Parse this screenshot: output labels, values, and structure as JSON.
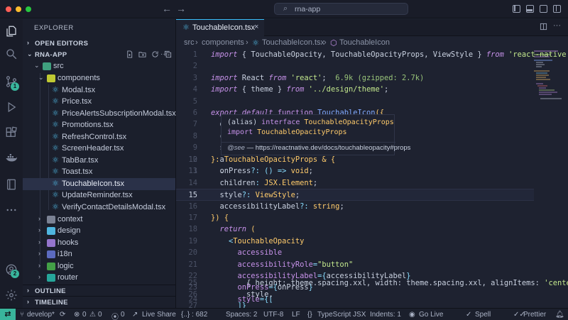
{
  "window": {
    "search_text": "rna-app"
  },
  "sidebar": {
    "title": "EXPLORER",
    "open_editors": "OPEN EDITORS",
    "project": "RNA-APP",
    "outline": "OUTLINE",
    "timeline": "TIMELINE",
    "tree": [
      {
        "name": "src"
      },
      {
        "name": "components"
      },
      {
        "name": "Modal.tsx"
      },
      {
        "name": "Price.tsx"
      },
      {
        "name": "PriceAlertsSubscriptionModal.tsx"
      },
      {
        "name": "Promotions.tsx"
      },
      {
        "name": "RefreshControl.tsx"
      },
      {
        "name": "ScreenHeader.tsx"
      },
      {
        "name": "TabBar.tsx"
      },
      {
        "name": "Toast.tsx"
      },
      {
        "name": "TouchableIcon.tsx"
      },
      {
        "name": "UpdateReminder.tsx"
      },
      {
        "name": "VerifyContactDetailsModal.tsx"
      },
      {
        "name": "context"
      },
      {
        "name": "design"
      },
      {
        "name": "hooks"
      },
      {
        "name": "i18n"
      },
      {
        "name": "logic"
      },
      {
        "name": "router"
      }
    ]
  },
  "activity": {
    "scm_badge": "1",
    "account_badge": "2"
  },
  "tab": {
    "label": "TouchableIcon.tsx"
  },
  "breadcrumb": [
    "src",
    "components",
    "TouchableIcon.tsx",
    "TouchableIcon"
  ],
  "code": {
    "line_numbers": [
      "1",
      "2",
      "3",
      "4",
      "5",
      "6",
      "7",
      "8",
      "9",
      "10",
      "11",
      "12",
      "13",
      "14",
      "15",
      "16",
      "17",
      "18",
      "19",
      "20",
      "21",
      "22",
      "23",
      "24",
      "25",
      "26",
      "27"
    ],
    "l1": {
      "a": "import",
      "b": " { TouchableOpacity, TouchableOpacityProps, ViewStyle } ",
      "c": "from",
      "d": " 'react-native'",
      "e": ";"
    },
    "l3": {
      "a": "import",
      "b": " React ",
      "c": "from",
      "d": " 'react'",
      "e": ";",
      "f": "  6.9k (gzipped: 2.7k)"
    },
    "l4": {
      "a": "import",
      "b": " { theme } ",
      "c": "from",
      "d": " '../design/theme'",
      "e": ";"
    },
    "l6": {
      "a": "export",
      "b": " default ",
      "c": "function",
      "d": " TouchableIcon",
      "e": "({"
    },
    "l7": "  onPress,",
    "l8": "  c",
    "l9": "  s",
    "l10": "  a",
    "l11": "  .",
    "l12": {
      "a": "}: ",
      "b": "TouchableOpacityProps",
      "c": " & {"
    },
    "l13": {
      "a": "  onPress",
      "b": "?: () => ",
      "c": "void",
      "d": ";"
    },
    "l14": {
      "a": "  children",
      "b": ": ",
      "c": "JSX.Element",
      "d": ";"
    },
    "l15": {
      "a": "  style",
      "b": "?: ",
      "c": "ViewStyle",
      "d": ";"
    },
    "l16": {
      "a": "  accessibilityLabel",
      "b": "?: ",
      "c": "string",
      "d": ";"
    },
    "l17": {
      "a": "}) {"
    },
    "l18": {
      "a": "  return",
      "b": " ("
    },
    "l19": {
      "a": "    <",
      "b": "TouchableOpacity"
    },
    "l20": "      accessible",
    "l21": {
      "a": "      accessibilityRole",
      "b": "=",
      "c": "\"button\""
    },
    "l22": {
      "a": "      accessibilityLabel",
      "b": "={",
      "c": "accessibilityLabel",
      "d": "}"
    },
    "l23": {
      "a": "      onPress",
      "b": "={",
      "c": "onPress",
      "d": "}"
    },
    "l24": {
      "a": "      style",
      "b": "={["
    },
    "l25": {
      "a": "        { height: theme.spacing.xxl, width: theme.spacing.xxl, alignItems: ",
      "b": "'center'",
      "c": ","
    },
    "l26": "        style,",
    "l27": "      ]}"
  },
  "hover": {
    "line1_a": "(alias) ",
    "line1_b": "interface",
    "line1_c": " TouchableOpacityProps",
    "line2_a": "import",
    "line2_b": " TouchableOpacityProps",
    "see_tag": "@see",
    "see_dash": " — ",
    "see_link": "https://reactnative.dev/docs/touchableopacity#props"
  },
  "statusbar": {
    "branch": "develop*",
    "errors": "0",
    "warnings": "0",
    "ports": "0",
    "live_share": "Live Share",
    "selection": "{..} : 682",
    "spaces": "Spaces: 2",
    "encoding": "UTF-8",
    "eol": "LF",
    "language": "TypeScript JSX",
    "indents": "Indents: 1",
    "go_live": "Go Live",
    "spell": "Spell",
    "prettier": "Prettier"
  },
  "colors": {
    "accent": "#39b59c",
    "tab_accent": "#38bdf8",
    "background": "#1e2230"
  }
}
